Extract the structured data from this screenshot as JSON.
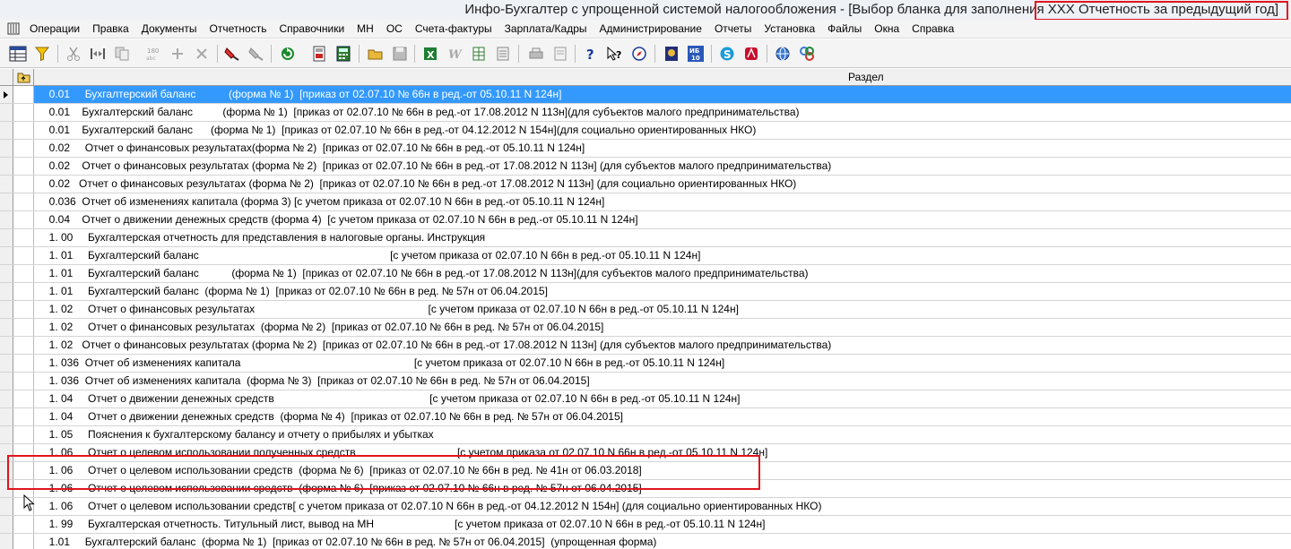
{
  "window": {
    "title": "Инфо-Бухгалтер с упрощенной системой налогообложения - [Выбор бланка для заполнения   XXX  Отчетность за предыдущий год]"
  },
  "menu": [
    "Операции",
    "Правка",
    "Документы",
    "Отчетность",
    "Справочники",
    "МН",
    "ОС",
    "Счета-фактуры",
    "Зарплата/Кадры",
    "Администрирование",
    "Отчеты",
    "Установка",
    "Файлы",
    "Окна",
    "Справка"
  ],
  "toolbar": {
    "buttons": [
      "table-grid-icon",
      "filter-icon",
      "scissors-icon",
      "join-icon",
      "copy-icon",
      "number-180-icon",
      "plus-icon",
      "cross-icon",
      "marker-icon",
      "remove-marker-icon",
      "refresh-icon",
      "export-doc-icon",
      "calculator-icon",
      "open-folder-icon",
      "save-icon",
      "excel-icon",
      "word-icon",
      "spreadsheet-icon",
      "form-icon",
      "printer-icon",
      "preview-icon",
      "help-icon",
      "context-help-icon",
      "compass-icon",
      "book-icon",
      "ib10-icon",
      "skype-icon",
      "adobe-icon",
      "globe-icon",
      "link-icon"
    ],
    "ib10_label": "ИБ\n10"
  },
  "grid": {
    "column_header": "Раздел",
    "selected_index": 0,
    "rows": [
      "     0.01     Бухгалтерский баланс           (форма № 1)  [приказ от 02.07.10 № 66н в ред.-от 05.10.11 N 124н]",
      "     0.01    Бухгалтерский баланс          (форма № 1)  [приказ от 02.07.10 № 66н в ред.-от 17.08.2012 N 113н](для субъектов малого предпринимательства)",
      "     0.01    Бухгалтерский баланс      (форма № 1)  [приказ от 02.07.10 № 66н в ред.-от 04.12.2012 N 154н](для социально ориентированных НКО)",
      "     0.02     Отчет о финансовых результатах(форма № 2)  [приказ от 02.07.10 № 66н в ред.-от 05.10.11 N 124н]",
      "     0.02    Отчет о финансовых результатах (форма № 2)  [приказ от 02.07.10 № 66н в ред.-от 17.08.2012 N 113н] (для субъектов малого предпринимательства)",
      "     0.02   Отчет о финансовых результатах (форма № 2)  [приказ от 02.07.10 № 66н в ред.-от 17.08.2012 N 113н] (для социально ориентированных НКО)",
      "     0.036  Отчет об изменениях капитала (форма 3) [с учетом приказа от 02.07.10 N 66н в ред.-от 05.10.11 N 124н]",
      "     0.04    Отчет о движении денежных средств (форма 4)  [с учетом приказа от 02.07.10 N 66н в ред.-от 05.10.11 N 124н]",
      "     1. 00     Бухгалтерская отчетность для представления в налоговые органы. Инструкция",
      "     1. 01     Бухгалтерский баланс                                                                [с учетом приказа от 02.07.10 N 66н в ред.-от 05.10.11 N 124н]",
      "     1. 01     Бухгалтерский баланс           (форма № 1)  [приказ от 02.07.10 № 66н в ред.-от 17.08.2012 N 113н](для субъектов малого предпринимательства)",
      "     1. 01     Бухгалтерский баланс  (форма № 1)  [приказ от 02.07.10 № 66н в ред. № 57н от 06.04.2015]",
      "     1. 02     Отчет о финансовых результатах                                                          [с учетом приказа от 02.07.10 N 66н в ред.-от 05.10.11 N 124н]",
      "     1. 02     Отчет о финансовых результатах  (форма № 2)  [приказ от 02.07.10 № 66н в ред. № 57н от 06.04.2015]",
      "     1. 02   Отчет о финансовых результатах (форма № 2)  [приказ от 02.07.10 № 66н в ред.-от 17.08.2012 N 113н] (для субъектов малого предпринимательства)",
      "     1. 036  Отчет об изменениях капитала                                                          [с учетом приказа от 02.07.10 N 66н в ред.-от 05.10.11 N 124н]",
      "     1. 036  Отчет об изменениях капитала  (форма № 3)  [приказ от 02.07.10 № 66н в ред. № 57н от 06.04.2015]",
      "     1. 04     Отчет о движении денежных средств                                                    [с учетом приказа от 02.07.10 N 66н в ред.-от 05.10.11 N 124н]",
      "     1. 04     Отчет о движении денежных средств  (форма № 4)  [приказ от 02.07.10 № 66н в ред. № 57н от 06.04.2015]",
      "     1. 05     Пояснения к бухгалтерскому балансу и отчету о прибылях и убытках",
      "     1. 06     Отчет о целевом использовании полученных средств                                  [с учетом приказа от 02.07.10 N 66н в ред.-от 05.10.11 N 124н]",
      "     1. 06     Отчет о целевом использовании средств  (форма № 6)  [приказ от 02.07.10 № 66н в ред. № 41н от 06.03.2018]",
      "     1. 06     Отчет о целевом использовании средств  (форма № 6)  [приказ от 02.07.10 № 66н в ред. № 57н от 06.04.2015]",
      "     1. 06     Отчет о целевом использовании средств[ с учетом приказа от 02.07.10 N 66н в ред.-от 04.12.2012 N 154н] (для социально ориентированных НКО)",
      "     1. 99     Бухгалтерская отчетность. Титульный лист, вывод на МН                           [с учетом приказа от 02.07.10 N 66н в ред.-от 05.10.11 N 124н]",
      "     1.01     Бухгалтерский баланс  (форма № 1)  [приказ от 02.07.10 № 66н в ред. № 57н от 06.04.2015]  (упрощенная форма)"
    ]
  },
  "colors": {
    "selection": "#3399ff",
    "highlight_box": "#e0141e"
  }
}
